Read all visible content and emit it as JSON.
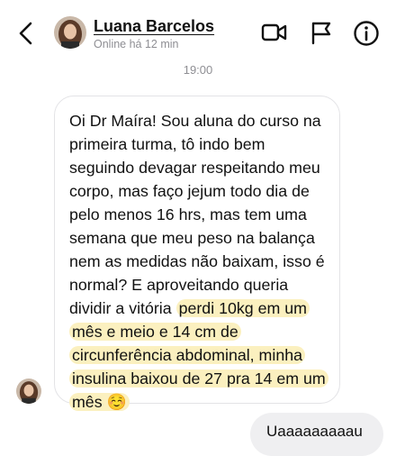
{
  "header": {
    "contact_name": "Luana Barcelos",
    "status": "Online há 12 min",
    "icons": [
      "back-chevron-icon",
      "video-call-icon",
      "flag-icon",
      "info-icon"
    ]
  },
  "conversation": {
    "timestamp": "19:00",
    "incoming_message": {
      "text_before": "Oi Dr Maíra! Sou aluna do curso na primeira turma, tô indo bem seguindo devagar respeitando meu corpo, mas faço jejum todo dia de pelo menos 16 hrs, mas tem uma semana que meu peso na balança nem as medidas não baixam, isso é normal? E aproveitando queria dividir a vitória",
      "highlighted": "perdi 10kg em um mês e meio e 14 cm de circunferência abdominal, minha insulina baixou de 27 pra 14 em um mês ☺️",
      "highlight_color": "#fbf0bf"
    },
    "outgoing_message": {
      "text": "Uaaaaaaaaau"
    }
  },
  "colors": {
    "incoming_border": "#e3e3e6",
    "outgoing_bubble": "#efeff1",
    "secondary_text": "#8e8e93"
  }
}
